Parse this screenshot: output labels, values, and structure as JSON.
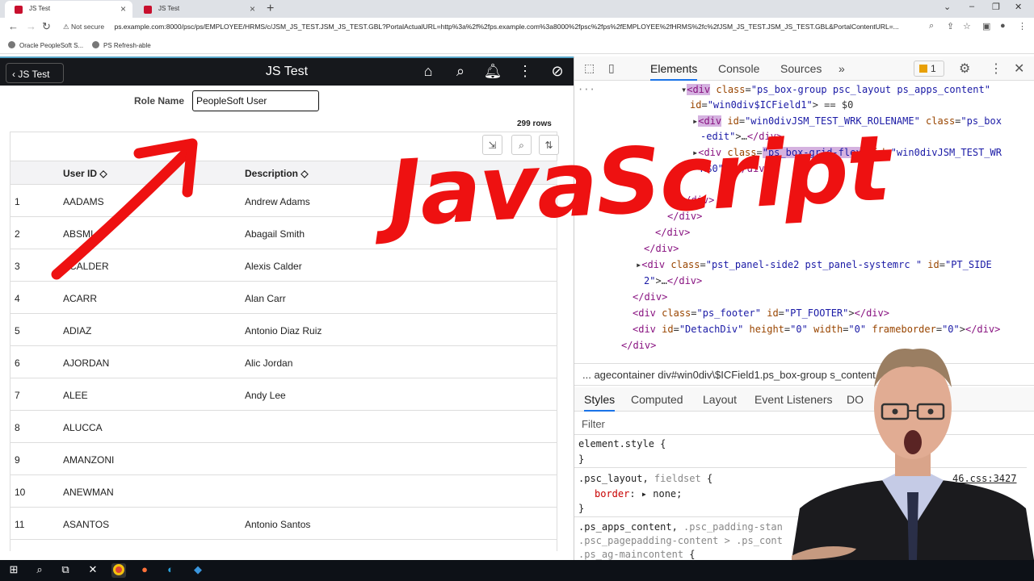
{
  "browser": {
    "tabs": [
      {
        "title": "JS Test",
        "active": true
      },
      {
        "title": "JS Test",
        "active": false
      }
    ],
    "address": {
      "security": "Not secure",
      "url": "ps.example.com:8000/psc/ps/EMPLOYEE/HRMS/c/JSM_JS_TEST.JSM_JS_TEST.GBL?PortalActualURL=http%3a%2f%2fps.example.com%3a8000%2fpsc%2fps%2fEMPLOYEE%2fHRMS%2fc%2fJSM_JS_TEST.JSM_JS_TEST.GBL&PortalContentURL=..."
    },
    "bookmarks": [
      "Oracle PeopleSoft S...",
      "PS Refresh-able"
    ]
  },
  "app": {
    "back_label": "JS Test",
    "title": "JS Test",
    "role_label": "Role Name",
    "role_value": "PeopleSoft User",
    "row_count": "299 rows",
    "columns": [
      "User ID",
      "Description"
    ],
    "rows": [
      {
        "n": "1",
        "id": "AADAMS",
        "desc": "Andrew Adams"
      },
      {
        "n": "2",
        "id": "ABSMI",
        "desc": "Abagail Smith"
      },
      {
        "n": "3",
        "id": "ACALDER",
        "desc": "Alexis Calder"
      },
      {
        "n": "4",
        "id": "ACARR",
        "desc": "Alan Carr"
      },
      {
        "n": "5",
        "id": "ADIAZ",
        "desc": "Antonio Diaz Ruiz"
      },
      {
        "n": "6",
        "id": "AJORDAN",
        "desc": "Alic Jordan"
      },
      {
        "n": "7",
        "id": "ALEE",
        "desc": "Andy Lee"
      },
      {
        "n": "8",
        "id": "ALUCCA",
        "desc": ""
      },
      {
        "n": "9",
        "id": "AMANZONI",
        "desc": ""
      },
      {
        "n": "10",
        "id": "ANEWMAN",
        "desc": ""
      },
      {
        "n": "11",
        "id": "ASANTOS",
        "desc": "Antonio Santos"
      }
    ]
  },
  "overlay": {
    "text": "JavaScript",
    "color": "#ee1111"
  },
  "devtools": {
    "tabs": [
      "Elements",
      "Console",
      "Sources"
    ],
    "issues_count": "1",
    "breadcrumb": "...  agecontainer   div#win0div\\$ICField1.ps_box-group   s_content",
    "style_tabs": [
      "Styles",
      "Computed",
      "Layout",
      "Event Listeners",
      "DO"
    ],
    "filter_placeholder": "Filter",
    "css_source": "46.css:3427"
  },
  "colors": {
    "header_bg": "#16181c",
    "accent": "#1a73e8",
    "overlay_red": "#ee1111"
  }
}
